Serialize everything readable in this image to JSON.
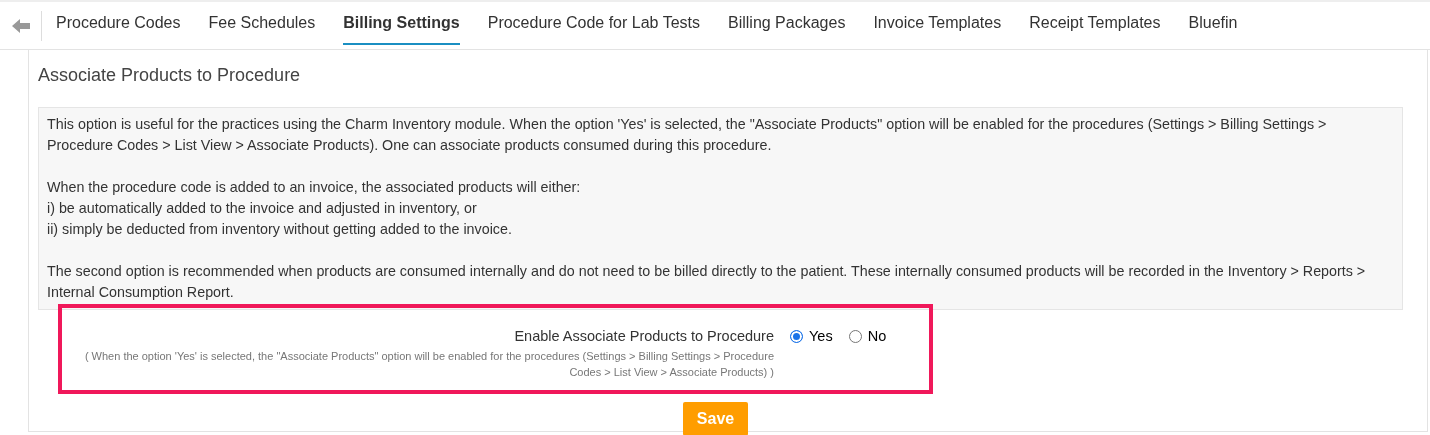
{
  "tabs": [
    {
      "label": "Procedure Codes",
      "selected": false
    },
    {
      "label": "Fee Schedules",
      "selected": false
    },
    {
      "label": "Billing Settings",
      "selected": true
    },
    {
      "label": "Procedure Code for Lab Tests",
      "selected": false
    },
    {
      "label": "Billing Packages",
      "selected": false
    },
    {
      "label": "Invoice Templates",
      "selected": false
    },
    {
      "label": "Receipt Templates",
      "selected": false
    },
    {
      "label": "Bluefin",
      "selected": false
    }
  ],
  "section_title": "Associate Products to Procedure",
  "info_paragraphs": [
    [
      "This option is useful for the practices using the Charm Inventory module. When the option 'Yes' is selected, the \"Associate Products\" option will be enabled for the procedures (Settings > Billing Settings > Procedure Codes > List View > Associate Products). One can associate products consumed during this procedure."
    ],
    [
      "When the procedure code is added to an invoice, the associated products will either:",
      "i) be automatically added to the invoice and adjusted in inventory, or",
      "ii) simply be deducted from inventory without getting added to the invoice."
    ],
    [
      "The second option is recommended when products are consumed internally and do not need to be billed directly to the patient. These internally consumed products will be recorded in the Inventory > Reports > Internal Consumption Report."
    ]
  ],
  "setting": {
    "label": "Enable Associate Products to Procedure",
    "hint": "( When the option 'Yes' is selected, the \"Associate Products\" option will be enabled for the procedures (Settings > Billing Settings > Procedure Codes > List View > Associate Products) )",
    "options": [
      {
        "label": "Yes",
        "selected": true
      },
      {
        "label": "No",
        "selected": false
      }
    ]
  },
  "save_button": "Save"
}
